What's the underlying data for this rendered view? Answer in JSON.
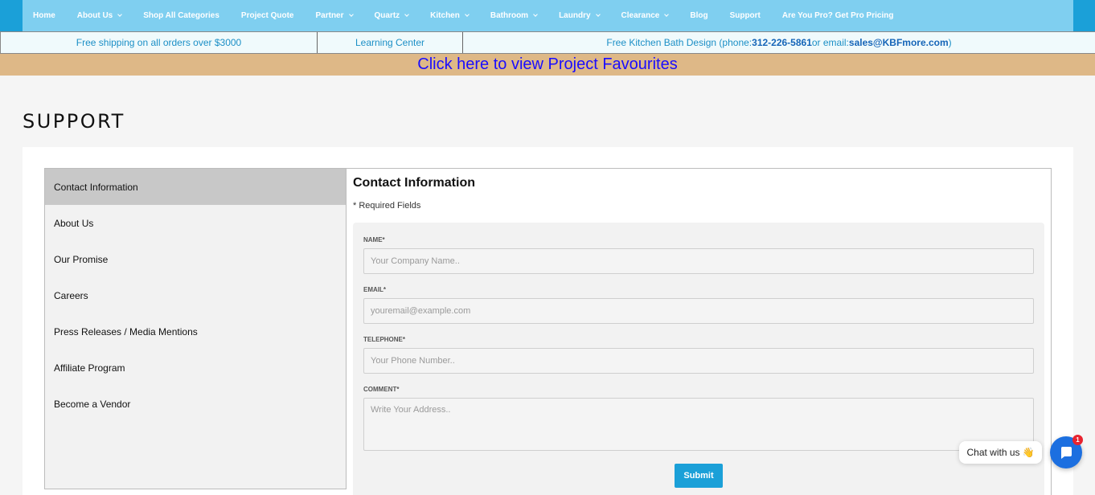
{
  "nav": {
    "items": [
      {
        "label": "Home",
        "dropdown": false
      },
      {
        "label": "About Us",
        "dropdown": true
      },
      {
        "label": "Shop All Categories",
        "dropdown": false
      },
      {
        "label": "Project Quote",
        "dropdown": false
      },
      {
        "label": "Partner",
        "dropdown": true
      },
      {
        "label": "Quartz",
        "dropdown": true
      },
      {
        "label": "Kitchen",
        "dropdown": true
      },
      {
        "label": "Bathroom",
        "dropdown": true
      },
      {
        "label": "Laundry",
        "dropdown": true
      },
      {
        "label": "Clearance",
        "dropdown": true
      },
      {
        "label": "Blog",
        "dropdown": false
      },
      {
        "label": "Support",
        "dropdown": false
      },
      {
        "label": "Are You Pro? Get Pro Pricing",
        "dropdown": false
      }
    ]
  },
  "infobar": {
    "shipping": "Free shipping on all orders over $3000",
    "learning": "Learning Center",
    "design_prefix": "Free Kitchen Bath Design (phone: ",
    "phone": "312-226-5861",
    "design_mid": " or email: ",
    "email": "sales@KBFmore.com",
    "design_suffix": ")"
  },
  "banner": {
    "text": "Click here to view Project Favourites"
  },
  "page": {
    "title": "SUPPORT"
  },
  "sidebar": {
    "items": [
      {
        "label": "Contact Information",
        "active": true
      },
      {
        "label": "About Us",
        "active": false
      },
      {
        "label": "Our Promise",
        "active": false
      },
      {
        "label": "Careers",
        "active": false
      },
      {
        "label": "Press Releases / Media Mentions",
        "active": false
      },
      {
        "label": "Affiliate Program",
        "active": false
      },
      {
        "label": "Become a Vendor",
        "active": false
      }
    ]
  },
  "form": {
    "heading": "Contact Information",
    "required_note": "* Required Fields",
    "name_label": "NAME*",
    "name_placeholder": "Your Company Name..",
    "email_label": "EMAIL*",
    "email_placeholder": "youremail@example.com",
    "telephone_label": "TELEPHONE*",
    "telephone_placeholder": "Your Phone Number..",
    "comment_label": "COMMENT*",
    "comment_placeholder": "Write Your Address..",
    "submit_label": "Submit"
  },
  "chat": {
    "label": "Chat with us",
    "wave": "👋",
    "badge": "1"
  },
  "colors": {
    "nav_bg": "#7fcff0",
    "accent": "#1ba0d8",
    "banner_bg": "#deb887",
    "chat_blue": "#1c6fe0",
    "badge_red": "#e8232f"
  }
}
